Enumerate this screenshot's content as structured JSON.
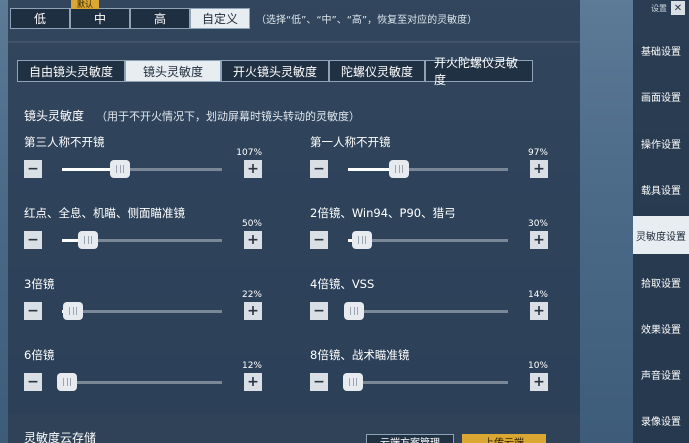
{
  "presets": {
    "items": [
      "低",
      "中",
      "高",
      "自定义"
    ],
    "active_index": 3,
    "default_tag": "默认",
    "hint": "（选择“低”、“中”、“高”，恢复至对应的灵敏度）"
  },
  "tabs": {
    "items": [
      "自由镜头灵敏度",
      "镜头灵敏度",
      "开火镜头灵敏度",
      "陀螺仪灵敏度",
      "开火陀螺仪灵敏度"
    ],
    "active_index": 1
  },
  "section": {
    "title": "镜头灵敏度",
    "hint": "（用于不开火情况下，划动屏幕时镜头转动的灵敏度）"
  },
  "sliders": [
    {
      "label": "第三人称不开镜",
      "percent": "107%",
      "value": 0.36
    },
    {
      "label": "第一人称不开镜",
      "percent": "97%",
      "value": 0.32
    },
    {
      "label": "红点、全息、机瞄、侧面瞄准镜",
      "percent": "50%",
      "value": 0.16
    },
    {
      "label": "2倍镜、Win94、P90、猎弓",
      "percent": "30%",
      "value": 0.09
    },
    {
      "label": "3倍镜",
      "percent": "22%",
      "value": 0.07
    },
    {
      "label": "4倍镜、VSS",
      "percent": "14%",
      "value": 0.04
    },
    {
      "label": "6倍镜",
      "percent": "12%",
      "value": 0.03
    },
    {
      "label": "8倍镜、战术瞄准镜",
      "percent": "10%",
      "value": 0.03
    }
  ],
  "stepper": {
    "minus": "−",
    "plus": "+"
  },
  "cloud": {
    "title": "灵敏度云存储",
    "btn_manage": "云端方案管理",
    "btn_upload": "上传云端"
  },
  "sidebar": {
    "header": "设置",
    "close": "✕",
    "items": [
      "基础设置",
      "画面设置",
      "操作设置",
      "载具设置",
      "灵敏度设置",
      "拾取设置",
      "效果设置",
      "声音设置",
      "录像设置"
    ],
    "active_index": 4
  }
}
